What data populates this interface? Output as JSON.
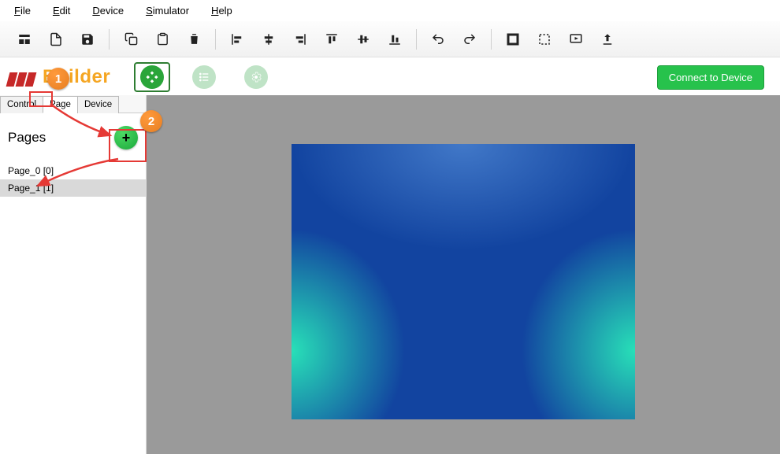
{
  "menu": {
    "file": "File",
    "edit": "Edit",
    "device": "Device",
    "simulator": "Simulator",
    "help": "Help"
  },
  "brand": {
    "title": "Builder"
  },
  "toolbar": {
    "new": "new-project",
    "open": "open",
    "save": "save",
    "copy": "copy",
    "paste": "paste",
    "delete": "delete",
    "al_left": "align-left",
    "al_hc": "align-h-center",
    "al_right": "align-right",
    "al_top": "align-top",
    "al_vc": "align-v-center",
    "al_bottom": "align-bottom",
    "undo": "undo",
    "redo": "redo",
    "frame": "frame",
    "select": "select-area",
    "preview": "preview",
    "upload": "upload"
  },
  "views": {
    "design": "design",
    "list": "list",
    "settings": "settings"
  },
  "connect_label": "Connect to Device",
  "sidebar": {
    "tabs": {
      "control": "Control",
      "page": "Page",
      "device": "Device"
    },
    "title": "Pages",
    "items": [
      "Page_0 [0]",
      "Page_1 [1]"
    ]
  },
  "annotations": {
    "step1": "1",
    "step2": "2"
  }
}
